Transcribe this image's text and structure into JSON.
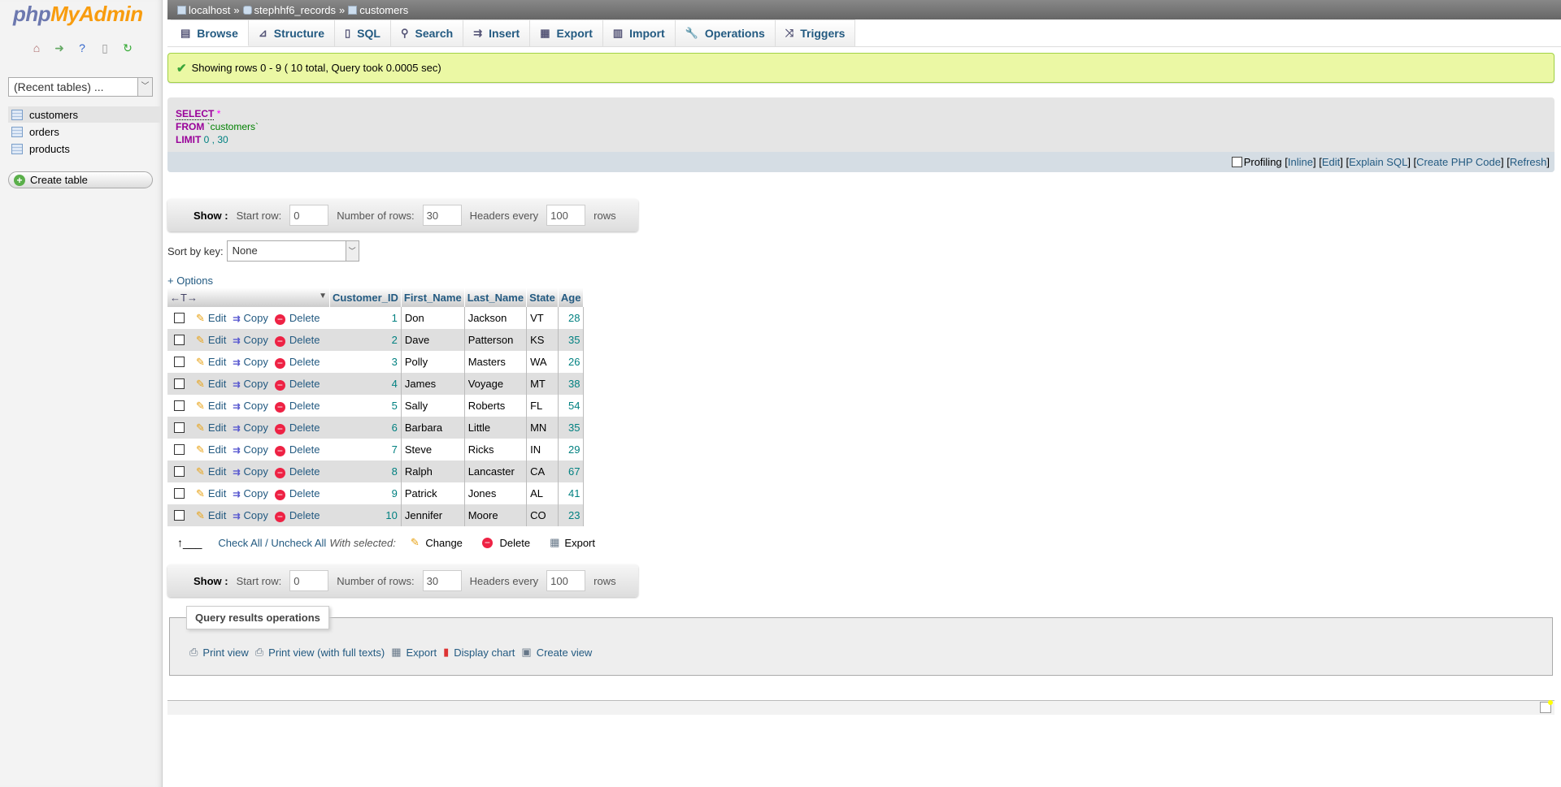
{
  "sidebar": {
    "logo_part1": "php",
    "logo_part2": "MyAdmin",
    "nav_icons": [
      "home-icon",
      "exit-icon",
      "help-icon",
      "docs-icon",
      "reload-icon"
    ],
    "recent_tables": "(Recent tables) ...",
    "tables": [
      {
        "name": "customers",
        "active": true
      },
      {
        "name": "orders",
        "active": false
      },
      {
        "name": "products",
        "active": false
      }
    ],
    "create_table": "Create table"
  },
  "breadcrumb": {
    "server": "localhost",
    "database": "stephhf6_records",
    "table": "customers",
    "separator": "»"
  },
  "tabs": [
    {
      "label": "Browse",
      "icon": "▤",
      "active": true
    },
    {
      "label": "Structure",
      "icon": "⊿",
      "active": false
    },
    {
      "label": "SQL",
      "icon": "▯",
      "active": false
    },
    {
      "label": "Search",
      "icon": "⚲",
      "active": false
    },
    {
      "label": "Insert",
      "icon": "⇉",
      "active": false
    },
    {
      "label": "Export",
      "icon": "▦",
      "active": false
    },
    {
      "label": "Import",
      "icon": "▥",
      "active": false
    },
    {
      "label": "Operations",
      "icon": "🔧",
      "active": false
    },
    {
      "label": "Triggers",
      "icon": "⤨",
      "active": false
    }
  ],
  "message": "Showing rows 0 - 9 ( 10 total, Query took 0.0005 sec)",
  "sql": {
    "select_kw": "SELECT",
    "star": "*",
    "from_kw": "FROM",
    "table": "`customers`",
    "limit_kw": "LIMIT",
    "limit_val": "0 , 30"
  },
  "sql_footer": {
    "profiling": "Profiling",
    "inline": "Inline",
    "edit": "Edit",
    "explain": "Explain SQL",
    "php": "Create PHP Code",
    "refresh": "Refresh"
  },
  "show_bar": {
    "show_label": "Show :",
    "start_row_label": "Start row:",
    "start_row": "0",
    "num_rows_label": "Number of rows:",
    "num_rows": "30",
    "headers_label": "Headers every",
    "headers": "100",
    "rows_label": "rows"
  },
  "sort": {
    "label": "Sort by key:",
    "value": "None"
  },
  "options_link": "+ Options",
  "grid": {
    "arrows": "←T→",
    "columns": [
      "Customer_ID",
      "First_Name",
      "Last_Name",
      "State",
      "Age"
    ],
    "actions": {
      "edit": "Edit",
      "copy": "Copy",
      "delete": "Delete"
    },
    "rows": [
      [
        "1",
        "Don",
        "Jackson",
        "VT",
        "28"
      ],
      [
        "2",
        "Dave",
        "Patterson",
        "KS",
        "35"
      ],
      [
        "3",
        "Polly",
        "Masters",
        "WA",
        "26"
      ],
      [
        "4",
        "James",
        "Voyage",
        "MT",
        "38"
      ],
      [
        "5",
        "Sally",
        "Roberts",
        "FL",
        "54"
      ],
      [
        "6",
        "Barbara",
        "Little",
        "MN",
        "35"
      ],
      [
        "7",
        "Steve",
        "Ricks",
        "IN",
        "29"
      ],
      [
        "8",
        "Ralph",
        "Lancaster",
        "CA",
        "67"
      ],
      [
        "9",
        "Patrick",
        "Jones",
        "AL",
        "41"
      ],
      [
        "10",
        "Jennifer",
        "Moore",
        "CO",
        "23"
      ]
    ]
  },
  "bulk": {
    "check_all": "Check All / Uncheck All",
    "with_selected": "With selected:",
    "change": "Change",
    "delete": "Delete",
    "export": "Export"
  },
  "query_ops": {
    "legend": "Query results operations",
    "print_view": "Print view",
    "print_full": "Print view (with full texts)",
    "export": "Export",
    "chart": "Display chart",
    "create_view": "Create view"
  }
}
